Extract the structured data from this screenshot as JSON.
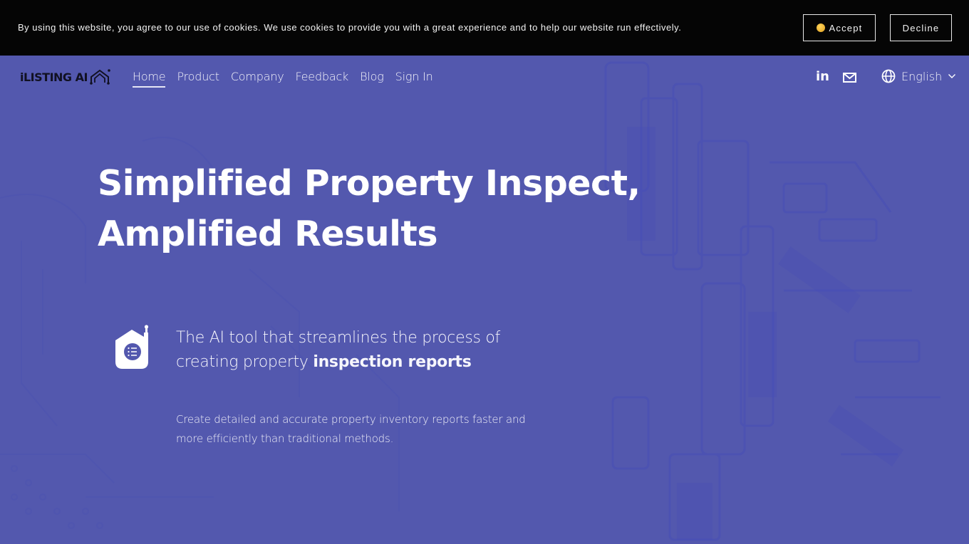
{
  "cookie_banner": {
    "message": "By using this website, you agree to our use of cookies. We use cookies to provide you with a great experience and to help our website run effectively.",
    "accept_label": "Accept",
    "accept_icon": "smiling-face-icon",
    "decline_label": "Decline"
  },
  "header": {
    "logo_text": "iLISTING AI",
    "logo_icon": "house-circuit-icon",
    "nav": [
      {
        "label": "Home",
        "active": true
      },
      {
        "label": "Product",
        "active": false
      },
      {
        "label": "Company",
        "active": false
      },
      {
        "label": "Feedback",
        "active": false
      },
      {
        "label": "Blog",
        "active": false
      },
      {
        "label": "Sign In",
        "active": false
      }
    ],
    "social": [
      {
        "icon": "linkedin-icon",
        "glyph": "in"
      },
      {
        "icon": "mail-icon"
      }
    ],
    "language": {
      "icon": "globe-icon",
      "selected": "English",
      "dropdown_icon": "chevron-down-icon"
    }
  },
  "hero": {
    "title_line1": "Simplified Property Inspect,",
    "title_line2": "Amplified Results",
    "tagline_plain": "The AI tool that streamlines the process of creating property ",
    "tagline_bold": "inspection reports",
    "feature_icon": "home-checklist-icon",
    "description": "Create detailed and accurate property inventory reports faster and more efficiently than traditional methods."
  },
  "colors": {
    "background": "#5358ae",
    "cookie_bar": "#050505",
    "text": "#ffffff",
    "logo_text": "#111122"
  }
}
